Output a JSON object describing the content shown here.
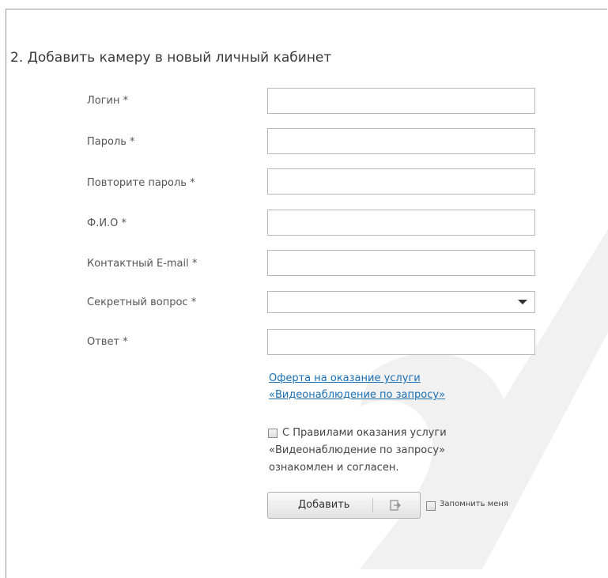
{
  "section": {
    "title": "2. Добавить камеру в новый личный кабинет"
  },
  "form": {
    "fields": [
      {
        "label": "Логин *",
        "value": ""
      },
      {
        "label": "Пароль *",
        "value": ""
      },
      {
        "label": "Повторите пароль *",
        "value": ""
      },
      {
        "label": "Ф.И.О *",
        "value": ""
      },
      {
        "label": "Контактный E-mail *",
        "value": ""
      },
      {
        "label": "Секретный вопрос *",
        "selected": ""
      },
      {
        "label": "Ответ *",
        "value": ""
      }
    ],
    "offer_link": {
      "line1": "Оферта на оказание услуги",
      "line2": "«Видеонаблюдение по запросу»"
    },
    "agreement": {
      "checked": false,
      "line1": "С Правилами оказания услуги",
      "line2": "«Видеонаблюдение по запросу»",
      "line3": "ознакомлен и согласен."
    },
    "submit_label": "Добавить",
    "remember": {
      "checked": false,
      "label": "Запомнить меня"
    }
  },
  "colors": {
    "link": "#1a6fb5",
    "border": "#b8b8b8",
    "watermark": "#f1f1f1"
  },
  "icons": {
    "select_arrow": "chevron-down-icon",
    "submit": "exit-icon"
  }
}
